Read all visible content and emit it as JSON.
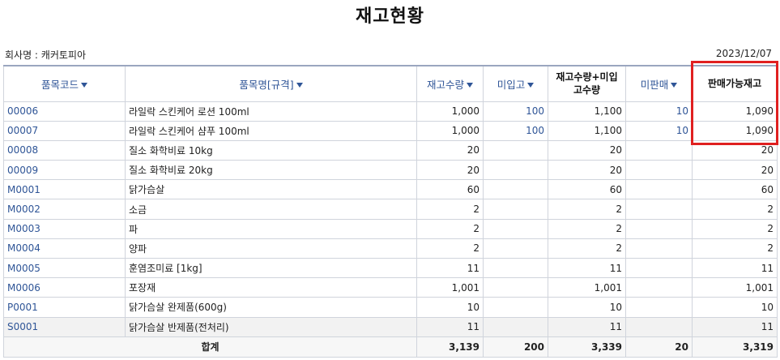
{
  "report": {
    "title": "재고현황",
    "company": "회사명 : 캐커토피아",
    "date": "2023/12/07"
  },
  "columns": {
    "code": "품목코드",
    "name": "품목명[규격]",
    "stock": "재고수량",
    "incoming": "미입고",
    "total_line1": "재고수량+미입",
    "total_line2": "고수량",
    "unsold": "미판매",
    "available": "판매가능재고"
  },
  "rows": [
    {
      "code": "00006",
      "name": "라일락 스킨케어 로션 100ml",
      "stock": "1,000",
      "incoming": "100",
      "total": "1,100",
      "unsold": "10",
      "available": "1,090"
    },
    {
      "code": "00007",
      "name": "라일락 스킨케어 샴푸 100ml",
      "stock": "1,000",
      "incoming": "100",
      "total": "1,100",
      "unsold": "10",
      "available": "1,090"
    },
    {
      "code": "00008",
      "name": "질소 화학비료 10kg",
      "stock": "20",
      "incoming": "",
      "total": "20",
      "unsold": "",
      "available": "20"
    },
    {
      "code": "00009",
      "name": "질소 화학비료 20kg",
      "stock": "20",
      "incoming": "",
      "total": "20",
      "unsold": "",
      "available": "20"
    },
    {
      "code": "M0001",
      "name": "닭가슴살",
      "stock": "60",
      "incoming": "",
      "total": "60",
      "unsold": "",
      "available": "60"
    },
    {
      "code": "M0002",
      "name": "소금",
      "stock": "2",
      "incoming": "",
      "total": "2",
      "unsold": "",
      "available": "2"
    },
    {
      "code": "M0003",
      "name": "파",
      "stock": "2",
      "incoming": "",
      "total": "2",
      "unsold": "",
      "available": "2"
    },
    {
      "code": "M0004",
      "name": "양파",
      "stock": "2",
      "incoming": "",
      "total": "2",
      "unsold": "",
      "available": "2"
    },
    {
      "code": "M0005",
      "name": "훈염조미료 [1kg]",
      "stock": "11",
      "incoming": "",
      "total": "11",
      "unsold": "",
      "available": "11"
    },
    {
      "code": "M0006",
      "name": "포장재",
      "stock": "1,001",
      "incoming": "",
      "total": "1,001",
      "unsold": "",
      "available": "1,001"
    },
    {
      "code": "P0001",
      "name": "닭가슴살 완제품(600g)",
      "stock": "10",
      "incoming": "",
      "total": "10",
      "unsold": "",
      "available": "10"
    },
    {
      "code": "S0001",
      "name": "닭가슴살 반제품(전처리)",
      "stock": "11",
      "incoming": "",
      "total": "11",
      "unsold": "",
      "available": "11"
    }
  ],
  "totals": {
    "label": "합계",
    "stock": "3,139",
    "incoming": "200",
    "total": "3,339",
    "unsold": "20",
    "available": "3,319"
  },
  "colors": {
    "header_link": "#2f5597",
    "highlight_box": "#e02020"
  }
}
